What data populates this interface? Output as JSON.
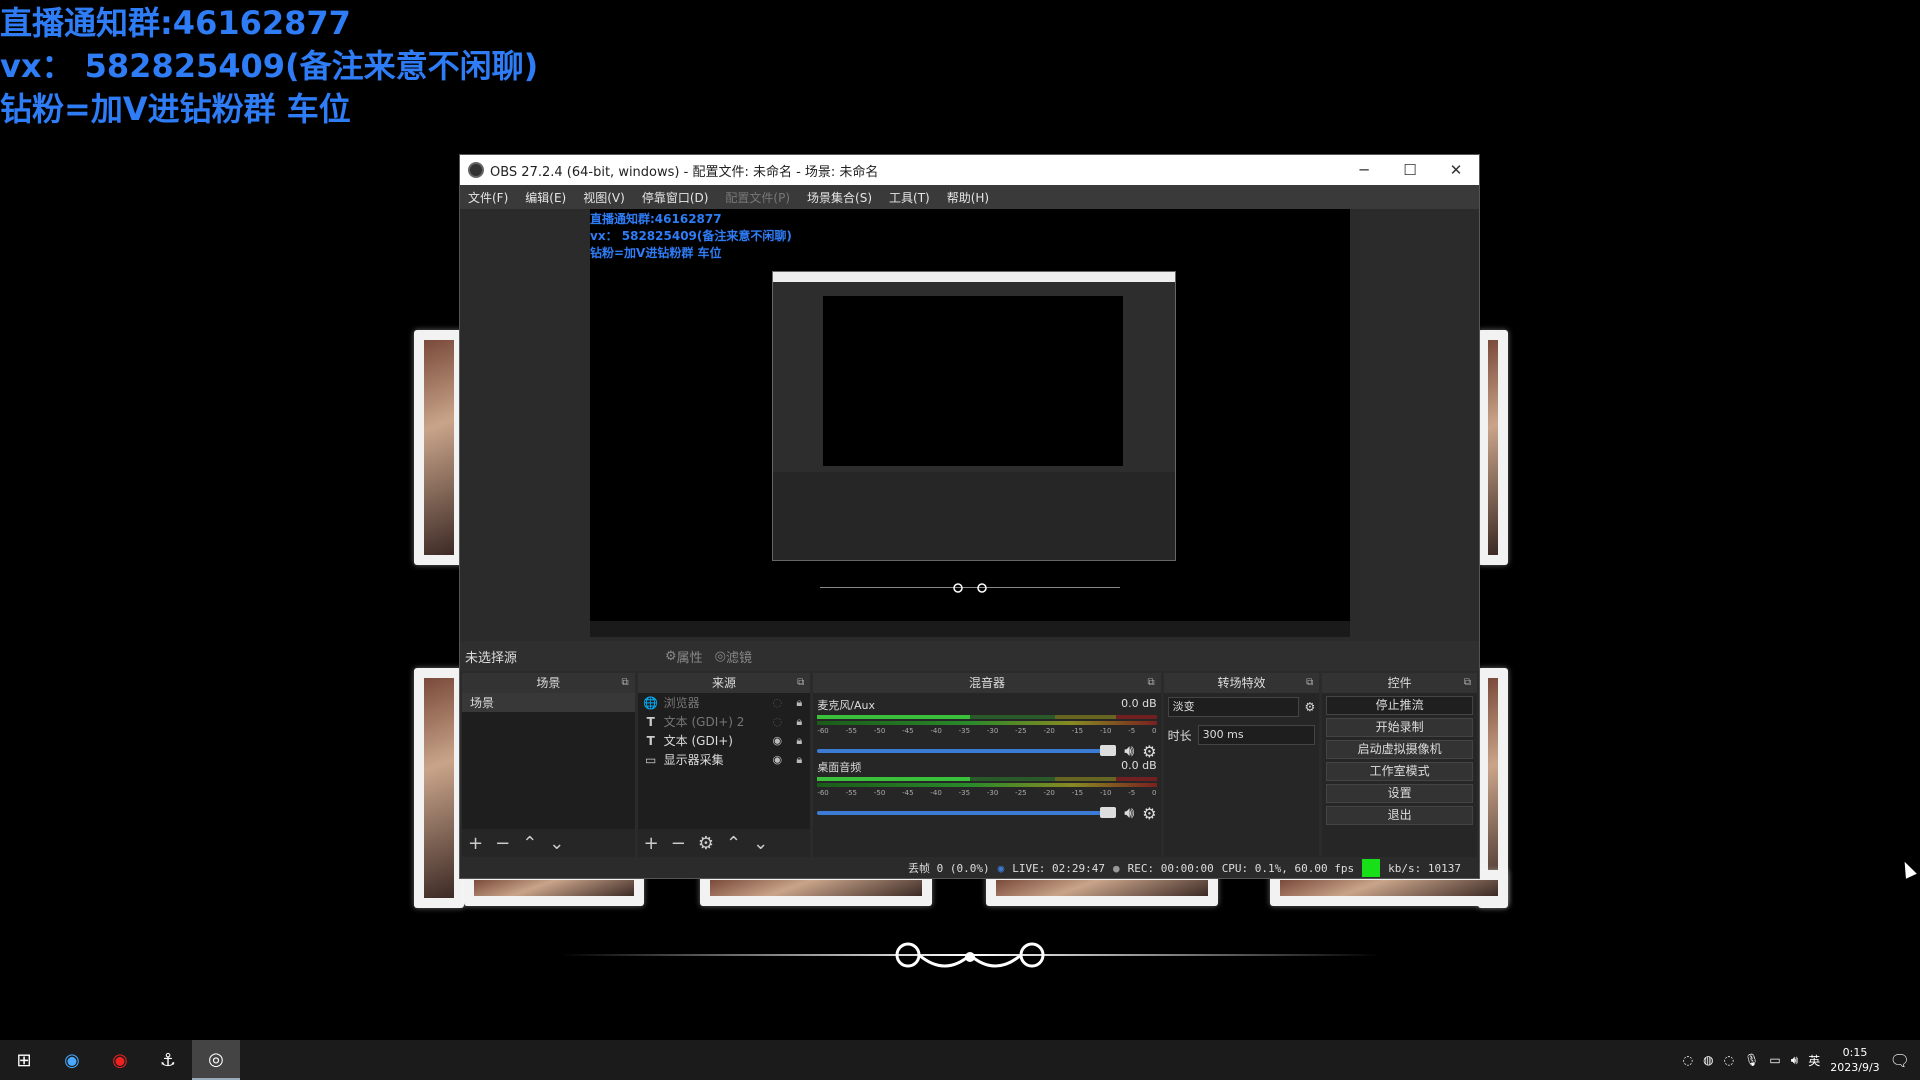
{
  "overlay": {
    "line1": "直播通知群:46162877",
    "line2": "vx：  582825409(备注来意不闲聊)",
    "line3": "钻粉=加V进钻粉群 车位"
  },
  "window": {
    "title": "OBS 27.2.4 (64-bit, windows) - 配置文件: 未命名 - 场景: 未命名",
    "minimize": "─",
    "maximize": "☐",
    "close": "✕"
  },
  "menu": [
    "文件(F)",
    "编辑(E)",
    "视图(V)",
    "停靠窗口(D)",
    "配置文件(P)",
    "场景集合(S)",
    "工具(T)",
    "帮助(H)"
  ],
  "source_bar": {
    "label": "未选择源",
    "properties": "属性",
    "filters": "滤镜"
  },
  "scenes": {
    "title": "场景",
    "items": [
      "场景"
    ]
  },
  "sources": {
    "title": "来源",
    "items": [
      {
        "icon": "browser-icon",
        "name": "浏览器",
        "visible": false
      },
      {
        "icon": "text-icon",
        "name": "文本 (GDI+) 2",
        "visible": false
      },
      {
        "icon": "text-icon",
        "name": "文本 (GDI+)",
        "visible": true
      },
      {
        "icon": "monitor-icon",
        "name": "显示器采集",
        "visible": true
      }
    ]
  },
  "mixer": {
    "title": "混音器",
    "channels": [
      {
        "name": "麦克风/Aux",
        "level": "0.0 dB"
      },
      {
        "name": "桌面音频",
        "level": "0.0 dB"
      }
    ],
    "ticks": [
      "-60",
      "-55",
      "-50",
      "-45",
      "-40",
      "-35",
      "-30",
      "-25",
      "-20",
      "-15",
      "-10",
      "-5",
      "0"
    ]
  },
  "transitions": {
    "title": "转场特效",
    "selected": "淡变",
    "duration_label": "时长",
    "duration_value": "300 ms"
  },
  "controls": {
    "title": "控件",
    "buttons": [
      "停止推流",
      "开始录制",
      "启动虚拟摄像机",
      "工作室模式",
      "设置",
      "退出"
    ]
  },
  "status": {
    "dropped": "丢帧 0 (0.0%)",
    "live": "LIVE: 02:29:47",
    "rec": "REC: 00:00:00",
    "cpu": "CPU: 0.1%, 60.00 fps",
    "kbs": "kb/s: 10137"
  },
  "taskbar": {
    "time": "0:15",
    "date": "2023/9/3",
    "ime": "英"
  },
  "colors": {
    "overlay_text": "#2e7cf6",
    "stream_ok": "#18e018"
  }
}
